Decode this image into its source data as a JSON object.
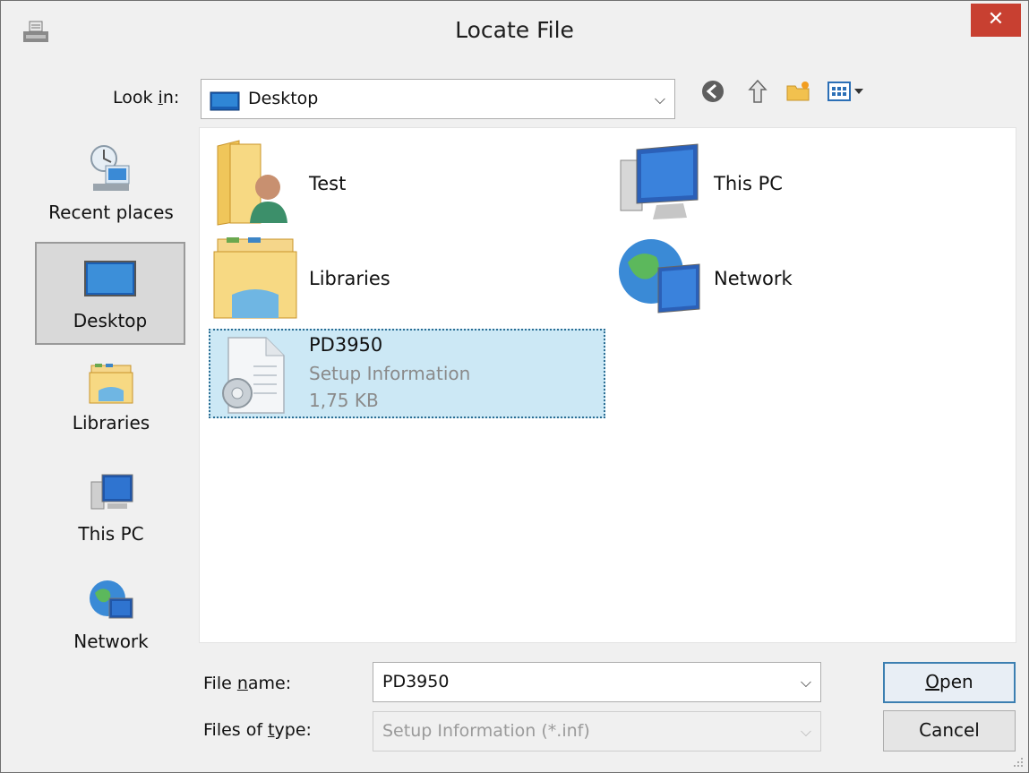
{
  "window": {
    "title": "Locate File",
    "close_symbol": "✕"
  },
  "lookin": {
    "label_pre": "Look ",
    "label_key": "i",
    "label_post": "n:",
    "value": "Desktop"
  },
  "places": [
    {
      "label": "Recent places",
      "icon": "recent-places-icon"
    },
    {
      "label": "Desktop",
      "icon": "desktop-icon",
      "selected": true
    },
    {
      "label": "Libraries",
      "icon": "libraries-icon"
    },
    {
      "label": "This PC",
      "icon": "this-pc-icon"
    },
    {
      "label": "Network",
      "icon": "network-icon"
    }
  ],
  "files": [
    {
      "name": "Test",
      "icon": "user-folder-icon"
    },
    {
      "name": "This PC",
      "icon": "this-pc-icon"
    },
    {
      "name": "Libraries",
      "icon": "libraries-icon"
    },
    {
      "name": "Network",
      "icon": "network-icon"
    },
    {
      "name": "PD3950",
      "type": "Setup Information",
      "size": "1,75 KB",
      "icon": "setup-file-icon",
      "selected": true
    }
  ],
  "filename": {
    "label_pre": "File ",
    "label_key": "n",
    "label_post": "ame:",
    "value": "PD3950"
  },
  "filetype": {
    "label_pre": "Files of ",
    "label_key": "t",
    "label_post": "ype:",
    "value": "Setup Information (*.inf)"
  },
  "buttons": {
    "open_key": "O",
    "open_rest": "pen",
    "cancel": "Cancel"
  },
  "colors": {
    "close": "#c84031",
    "selection": "#cce8f5",
    "default_button_border": "#3c7fb1"
  }
}
